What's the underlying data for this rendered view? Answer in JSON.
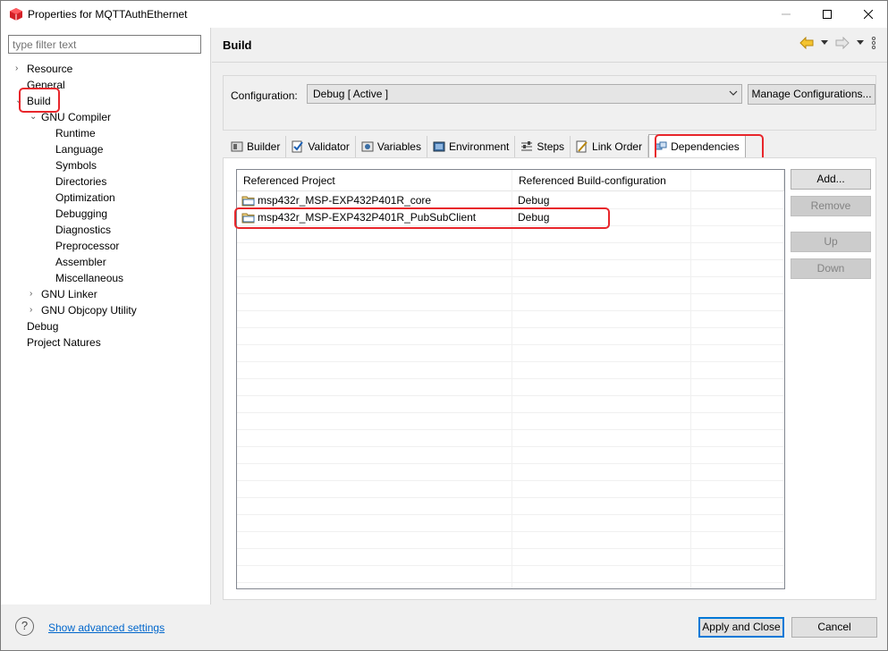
{
  "window": {
    "title": "Properties for MQTTAuthEthernet"
  },
  "filter": {
    "placeholder": "type filter text"
  },
  "tree": [
    {
      "label": "Resource",
      "toggle": "›"
    },
    {
      "label": "General",
      "toggle": ""
    },
    {
      "label": "Build",
      "toggle": "⌄"
    },
    {
      "label": "GNU Compiler",
      "toggle": "⌄"
    },
    {
      "label": "Runtime",
      "toggle": ""
    },
    {
      "label": "Language",
      "toggle": ""
    },
    {
      "label": "Symbols",
      "toggle": ""
    },
    {
      "label": "Directories",
      "toggle": ""
    },
    {
      "label": "Optimization",
      "toggle": ""
    },
    {
      "label": "Debugging",
      "toggle": ""
    },
    {
      "label": "Diagnostics",
      "toggle": ""
    },
    {
      "label": "Preprocessor",
      "toggle": ""
    },
    {
      "label": "Assembler",
      "toggle": ""
    },
    {
      "label": "Miscellaneous",
      "toggle": ""
    },
    {
      "label": "GNU Linker",
      "toggle": "›"
    },
    {
      "label": "GNU Objcopy Utility",
      "toggle": "›"
    },
    {
      "label": "Debug",
      "toggle": ""
    },
    {
      "label": "Project Natures",
      "toggle": ""
    }
  ],
  "header": {
    "title": "Build"
  },
  "configuration": {
    "label": "Configuration:",
    "value": "Debug  [ Active ]",
    "manage_label": "Manage Configurations..."
  },
  "tabs": [
    {
      "label": "Builder",
      "icon": "builder-icon"
    },
    {
      "label": "Validator",
      "icon": "validator-icon"
    },
    {
      "label": "Variables",
      "icon": "variables-icon"
    },
    {
      "label": "Environment",
      "icon": "environment-icon"
    },
    {
      "label": "Steps",
      "icon": "steps-icon"
    },
    {
      "label": "Link Order",
      "icon": "link-order-icon"
    },
    {
      "label": "Dependencies",
      "icon": "dependencies-icon"
    }
  ],
  "dependencies_table": {
    "columns": [
      "Referenced Project",
      "Referenced Build-configuration"
    ],
    "rows": [
      {
        "project": "msp432r_MSP-EXP432P401R_core",
        "config": "Debug"
      },
      {
        "project": "msp432r_MSP-EXP432P401R_PubSubClient",
        "config": "Debug"
      }
    ]
  },
  "side_buttons": {
    "add": "Add...",
    "remove": "Remove",
    "up": "Up",
    "down": "Down"
  },
  "footer": {
    "help_icon": "?",
    "advanced_link": "Show advanced settings",
    "apply_close": "Apply and Close",
    "cancel": "Cancel"
  },
  "colors": {
    "highlight": "#e8262b",
    "link": "#0066cc",
    "selected_button_border": "#0078d7"
  }
}
